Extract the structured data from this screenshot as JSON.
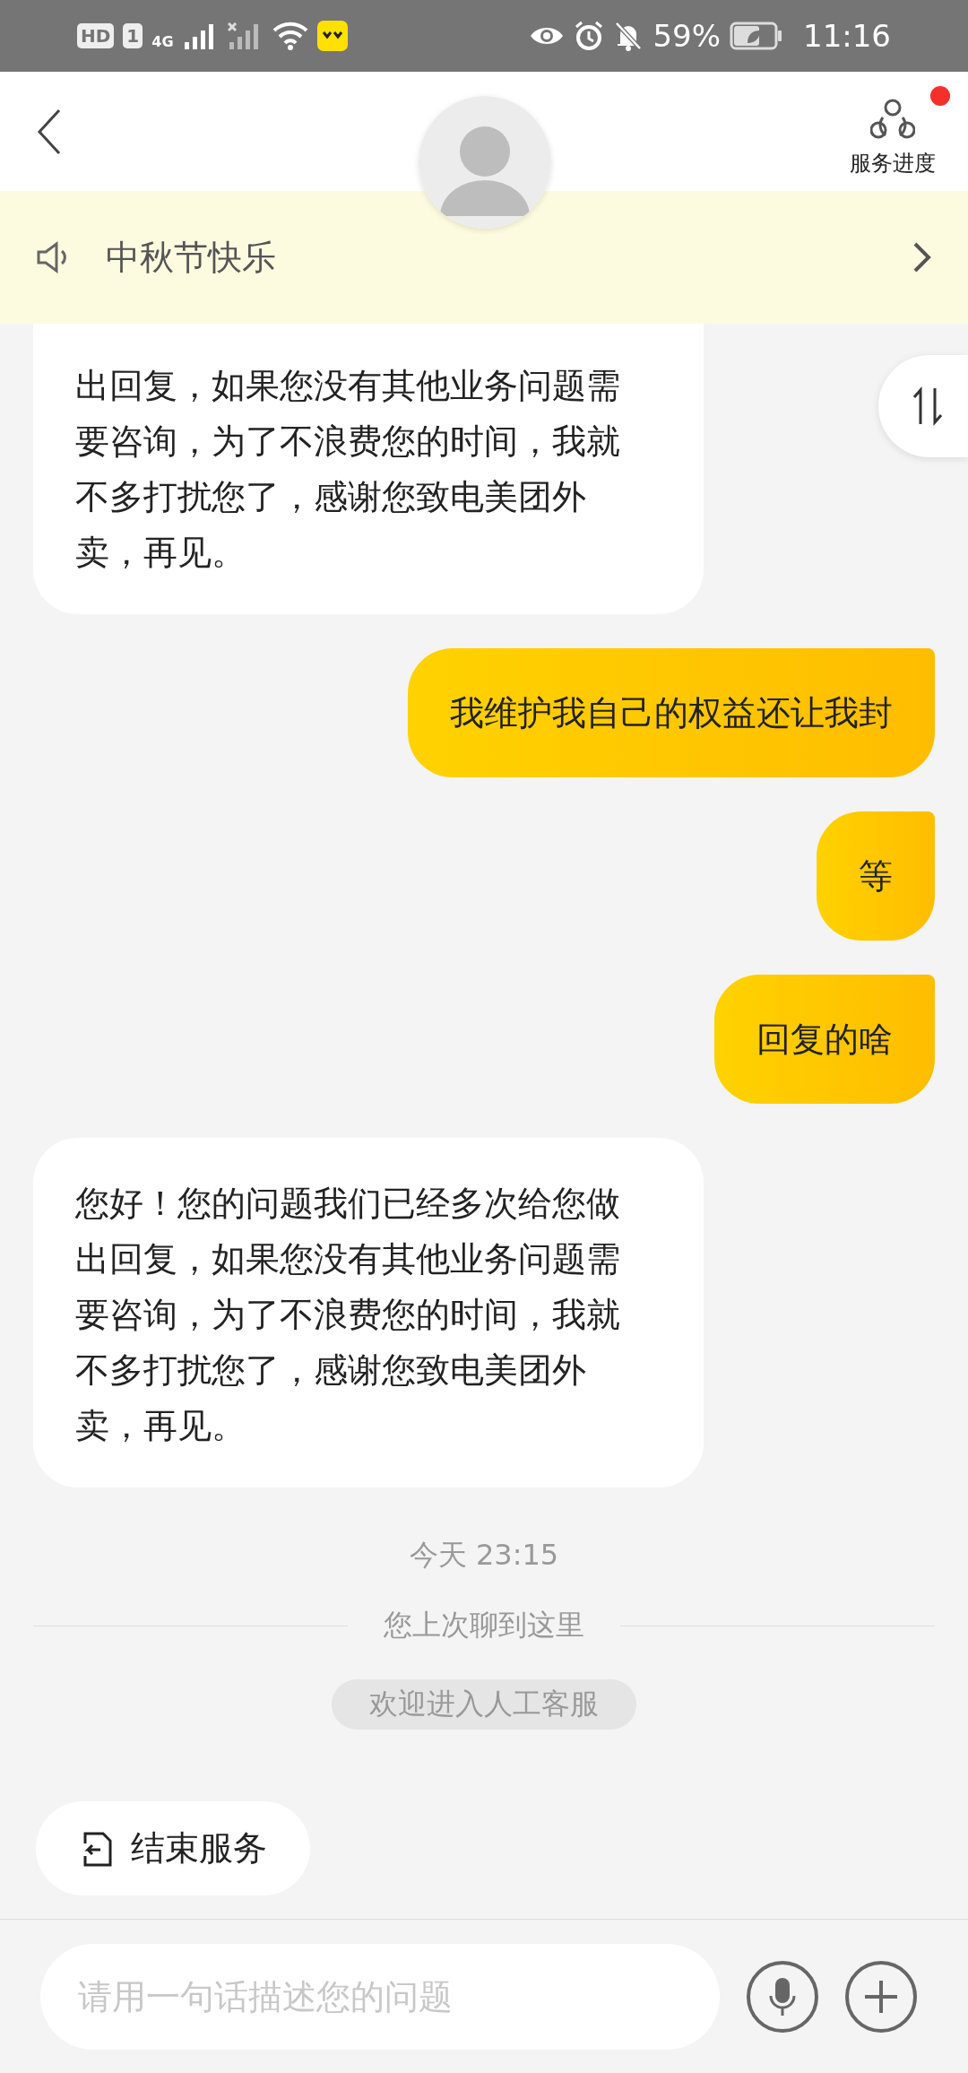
{
  "status_bar": {
    "hd": "HD",
    "sim": "1",
    "network": "4G",
    "battery": "59%",
    "time": "11:16"
  },
  "header": {
    "progress_label": "服务进度",
    "has_notification": true
  },
  "announcement": {
    "text": "中秋节快乐"
  },
  "messages": [
    {
      "kind": "incoming_partial",
      "text": "出回复，如果您没有其他业务问题需要咨询，为了不浪费您的时间，我就不多打扰您了，感谢您致电美团外卖，再见。"
    },
    {
      "kind": "outgoing",
      "text": "我维护我自己的权益还让我封"
    },
    {
      "kind": "outgoing",
      "text": "等"
    },
    {
      "kind": "outgoing",
      "text": "回复的啥"
    },
    {
      "kind": "incoming",
      "text": "您好！您的问题我们已经多次给您做出回复，如果您没有其他业务问题需要咨询，为了不浪费您的时间，我就不多打扰您了，感谢您致电美团外卖，再见。"
    },
    {
      "kind": "timestamp",
      "text": "今天 23:15"
    },
    {
      "kind": "divider",
      "text": "您上次聊到这里"
    },
    {
      "kind": "notice",
      "text": "欢迎进入人工客服"
    }
  ],
  "quick_actions": [
    {
      "label": "结束服务"
    }
  ],
  "composer": {
    "placeholder": "请用一句话描述您的问题"
  }
}
